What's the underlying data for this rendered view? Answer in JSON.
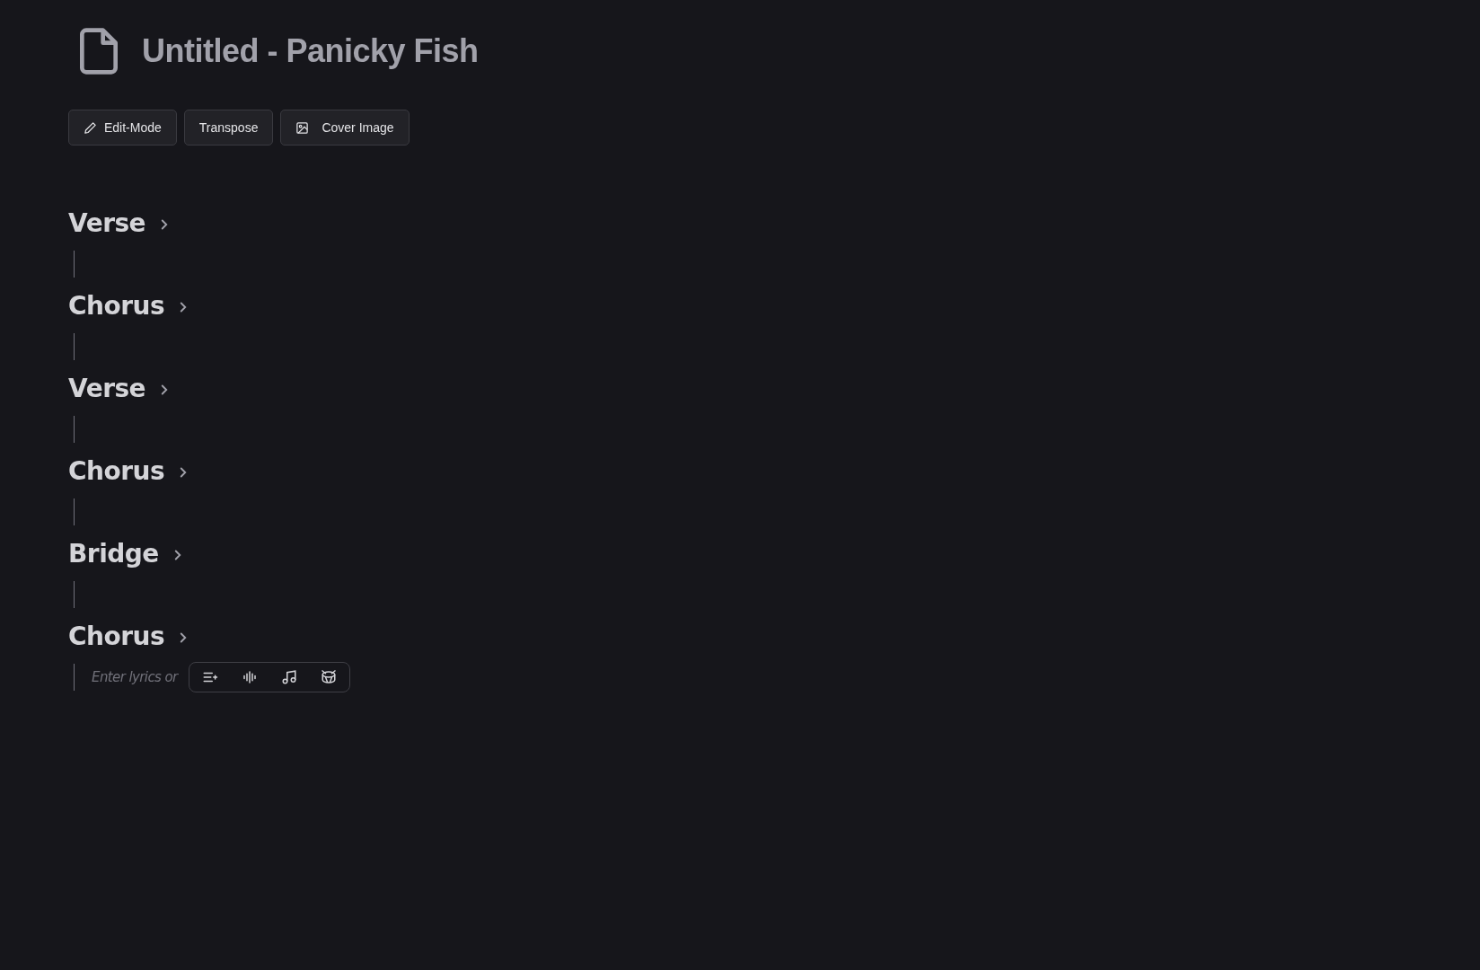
{
  "title": "Untitled - Panicky Fish",
  "buttons": [
    {
      "label": "Edit-Mode",
      "kind": "pencil"
    },
    {
      "label": "Transpose",
      "kind": "plain"
    },
    {
      "label": "Cover Image",
      "kind": "image"
    }
  ],
  "sections": [
    {
      "name": "Verse"
    },
    {
      "name": "Chorus"
    },
    {
      "name": "Verse"
    },
    {
      "name": "Chorus"
    },
    {
      "name": "Bridge"
    },
    {
      "name": "Chorus",
      "placeholder": "Enter lyrics or",
      "toolbar": [
        {
          "kind": "lines"
        },
        {
          "kind": "wave"
        },
        {
          "kind": "note"
        },
        {
          "kind": "drum"
        }
      ]
    }
  ]
}
